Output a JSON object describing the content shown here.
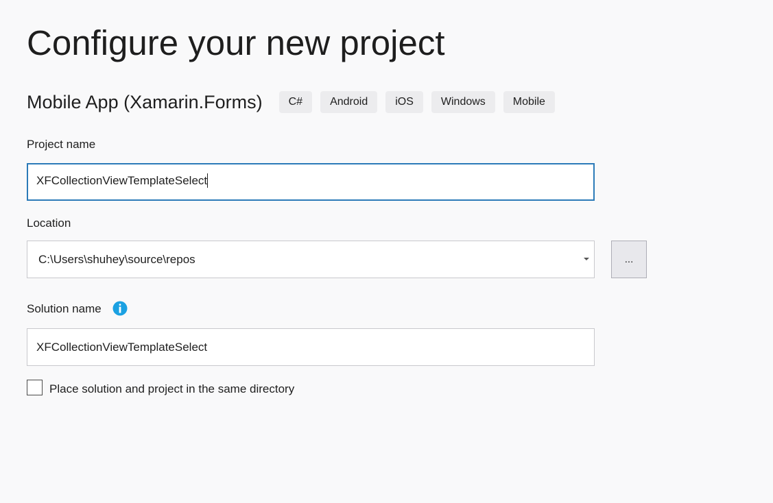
{
  "page_title": "Configure your new project",
  "template": {
    "name": "Mobile App (Xamarin.Forms)",
    "tags": [
      "C#",
      "Android",
      "iOS",
      "Windows",
      "Mobile"
    ]
  },
  "project_name": {
    "label": "Project name",
    "value": "XFCollectionViewTemplateSelect"
  },
  "location": {
    "label": "Location",
    "value": "C:\\Users\\shuhey\\source\\repos",
    "browse_label": "..."
  },
  "solution_name": {
    "label": "Solution name",
    "value": "XFCollectionViewTemplateSelect",
    "info_icon": "info-icon"
  },
  "same_directory": {
    "label": "Place solution and project in the same directory",
    "checked": false
  },
  "colors": {
    "accent": "#2b7ab8",
    "info": "#1ba1e2"
  }
}
